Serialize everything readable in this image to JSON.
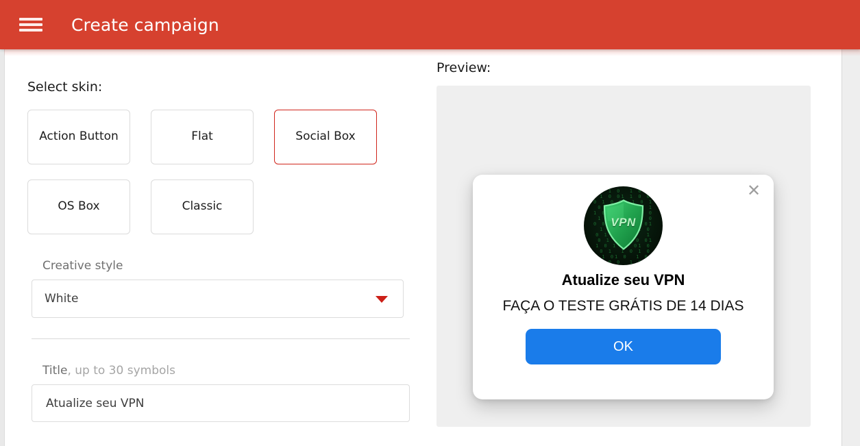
{
  "header": {
    "menu_icon": "hamburger-icon",
    "title": "Create campaign",
    "background_color": "#d6412f"
  },
  "form": {
    "skin": {
      "label": "Select skin:",
      "options": [
        {
          "label": "Action Button",
          "selected": false
        },
        {
          "label": "Flat",
          "selected": false
        },
        {
          "label": "Social Box",
          "selected": true
        },
        {
          "label": "OS Box",
          "selected": false
        },
        {
          "label": "Classic",
          "selected": false
        }
      ],
      "selected_value": "Social Box",
      "selected_border_color": "#d0241b"
    },
    "creative_style": {
      "label": "Creative style",
      "value": "White",
      "caret_icon": "chevron-down-icon",
      "caret_color": "#cc2018"
    },
    "title_field": {
      "label_main": "Title",
      "label_hint": ", up to 30 symbols",
      "value": "Atualize seu VPN",
      "placeholder": "Atualize seu VPN"
    }
  },
  "preview": {
    "label": "Preview:",
    "stage_background": "#efefef",
    "modal": {
      "close_icon": "close-icon",
      "logo_icon": "vpn-shield-logo",
      "logo_text": "VPN",
      "title": "Atualize seu VPN",
      "body": "FAÇA O TESTE GRÁTIS DE 14 DIAS",
      "ok_label": "OK",
      "ok_color": "#1a7cea"
    }
  }
}
